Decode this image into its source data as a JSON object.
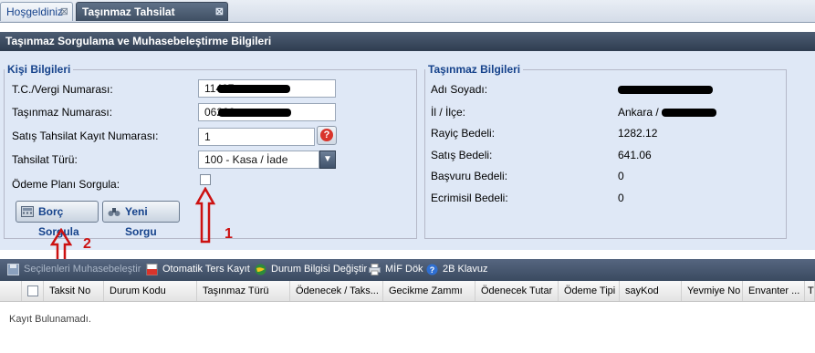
{
  "tabs": [
    {
      "label": "Hoşgeldiniz",
      "active": false
    },
    {
      "label": "Taşınmaz Tahsilat Ekranı",
      "active": true
    }
  ],
  "main_title": "Taşınmaz Sorgulama ve Muhasebeleştirme Bilgileri",
  "person": {
    "legend": "Kişi Bilgileri",
    "tc_label": "T.C./Vergi Numarası:",
    "tc_value": "11407",
    "tasinmaz_label": "Taşınmaz Numarası:",
    "tasinmaz_value": "06220",
    "kayit_label": "Satış Tahsilat Kayıt Numarası:",
    "kayit_value": "1",
    "tur_label": "Tahsilat Türü:",
    "tur_value": "100 - Kasa / İade",
    "odeme_label": "Ödeme Planı Sorgula:",
    "borc_button": "Borç Sorgula",
    "yeni_button": "Yeni Sorgu"
  },
  "property": {
    "legend": "Taşınmaz Bilgileri",
    "rows": [
      {
        "label": "Adı Soyadı:",
        "value": ""
      },
      {
        "label": "İl / İlçe:",
        "value": "Ankara /"
      },
      {
        "label": "Rayiç Bedeli:",
        "value": "1282.12"
      },
      {
        "label": "Satış Bedeli:",
        "value": "641.06"
      },
      {
        "label": "Başvuru Bedeli:",
        "value": "0"
      },
      {
        "label": "Ecrimisil Bedeli:",
        "value": "0"
      }
    ]
  },
  "annotations": {
    "one": "1",
    "two": "2"
  },
  "toolbar": {
    "muhasebe": "Seçilenleri Muhasebeleştir",
    "ters_kayit": "Otomatik Ters Kayıt",
    "durum": "Durum Bilgisi Değiştir",
    "mif": "MİF Dök",
    "klavuz": "2B Klavuz"
  },
  "grid": {
    "columns": [
      "Taksit No",
      "Durum Kodu",
      "Taşınmaz Türü",
      "Ödenecek / Taks...",
      "Gecikme Zammı",
      "Ödenecek Tutar",
      "Ödeme Tipi",
      "sayKod",
      "Yevmiye No",
      "Envanter ...",
      "T"
    ],
    "empty_text": "Kayıt Bulunamadı."
  },
  "colors": {
    "header_dark": "#3a4a60",
    "panel_bg": "#dfe8f6",
    "accent_red": "#cc1111",
    "link_blue": "#15428b"
  }
}
